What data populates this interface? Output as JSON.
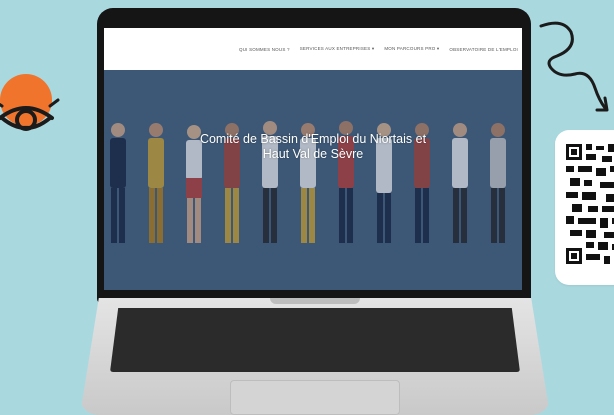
{
  "colors": {
    "background": "#a9d9df",
    "accent_orange": "#f0742b",
    "dark": "#1b1b1b"
  },
  "icons": {
    "eye": "eye-icon",
    "arrow": "squiggle-arrow-icon",
    "qr": "qr-code-icon"
  },
  "website": {
    "nav": [
      "QUI SOMMES NOUS ?",
      "SERVICES AUX ENTREPRISES ▾",
      "MON PARCOURS PRO ▾",
      "OBSERVATOIRE DE L'EMPLOI"
    ],
    "hero_title_line1": "Comité de Bassin d'Emploi du Niortais et",
    "hero_title_line2": "Haut Val de Sèvre"
  }
}
